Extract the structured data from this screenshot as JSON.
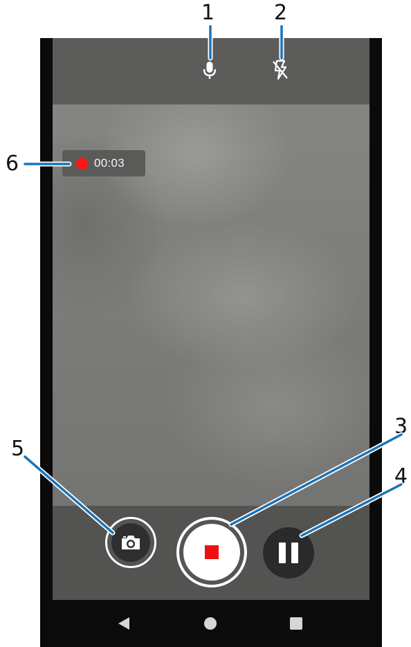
{
  "callouts": {
    "mic": "1",
    "flash": "2",
    "stop": "3",
    "pause": "4",
    "snapshot": "5",
    "recording_indicator": "6"
  },
  "recording": {
    "elapsed": "00:03",
    "indicator_color": "#ff1414"
  },
  "top_controls": [
    {
      "icon": "microphone-icon"
    },
    {
      "icon": "flash-off-icon"
    }
  ],
  "bottom_controls": [
    {
      "icon": "camera-icon",
      "action": "snapshot"
    },
    {
      "icon": "stop-icon",
      "action": "stop recording",
      "color": "#ee1010"
    },
    {
      "icon": "pause-icon",
      "action": "pause recording"
    }
  ],
  "nav_bar": [
    {
      "icon": "back-triangle-icon"
    },
    {
      "icon": "home-circle-icon"
    },
    {
      "icon": "recents-square-icon"
    }
  ],
  "colors": {
    "callout_line": "#1a74b8",
    "callout_text": "#111111"
  }
}
